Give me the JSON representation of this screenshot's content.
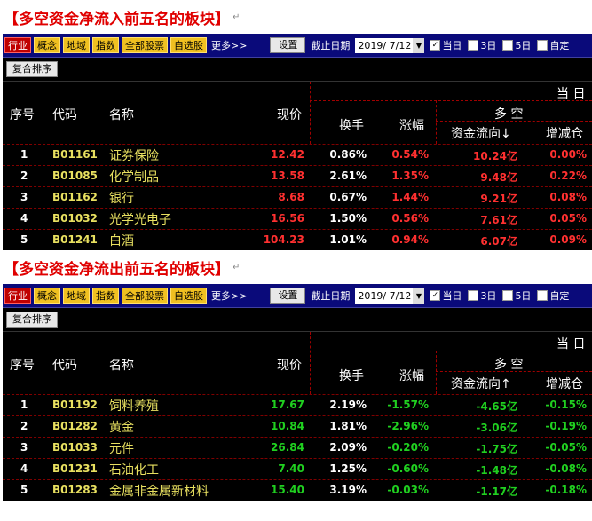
{
  "sections": [
    {
      "title": "【多空资金净流入前五名的板块】",
      "mark": "↵",
      "tabs": [
        "行业",
        "概念",
        "地域",
        "指数",
        "全部股票",
        "自选股"
      ],
      "active_tab": 0,
      "more": "更多>>",
      "set_button": "设置",
      "date_label": "截止日期",
      "date_value": "2019/ 7/12",
      "checks": [
        {
          "label": "当日",
          "checked": true
        },
        {
          "label": "3日",
          "checked": false
        },
        {
          "label": "5日",
          "checked": false
        },
        {
          "label": "自定",
          "checked": false
        }
      ],
      "sort_button": "复合排序",
      "headers": {
        "seq": "序号",
        "code": "代码",
        "name": "名称",
        "price": "现价",
        "group": "当 日",
        "sub": "多 空",
        "turnover": "换手",
        "change": "涨幅",
        "flow": "资金流向↓",
        "pos": "增减仓"
      },
      "color": "red",
      "rows": [
        {
          "seq": "1",
          "code": "B01161",
          "name": "证券保险",
          "price": "12.42",
          "turnover": "0.86%",
          "change": "0.54%",
          "flow": "10.24亿",
          "pos": "0.00%"
        },
        {
          "seq": "2",
          "code": "B01085",
          "name": "化学制品",
          "price": "13.58",
          "turnover": "2.61%",
          "change": "1.35%",
          "flow": "9.48亿",
          "pos": "0.22%"
        },
        {
          "seq": "3",
          "code": "B01162",
          "name": "银行",
          "price": "8.68",
          "turnover": "0.67%",
          "change": "1.44%",
          "flow": "9.21亿",
          "pos": "0.08%"
        },
        {
          "seq": "4",
          "code": "B01032",
          "name": "光学光电子",
          "price": "16.56",
          "turnover": "1.50%",
          "change": "0.56%",
          "flow": "7.61亿",
          "pos": "0.05%"
        },
        {
          "seq": "5",
          "code": "B01241",
          "name": "白酒",
          "price": "104.23",
          "turnover": "1.01%",
          "change": "0.94%",
          "flow": "6.07亿",
          "pos": "0.09%"
        }
      ]
    },
    {
      "title": "【多空资金净流出前五名的板块】",
      "mark": "↵",
      "tabs": [
        "行业",
        "概念",
        "地域",
        "指数",
        "全部股票",
        "自选股"
      ],
      "active_tab": 0,
      "more": "更多>>",
      "set_button": "设置",
      "date_label": "截止日期",
      "date_value": "2019/ 7/12",
      "checks": [
        {
          "label": "当日",
          "checked": true
        },
        {
          "label": "3日",
          "checked": false
        },
        {
          "label": "5日",
          "checked": false
        },
        {
          "label": "自定",
          "checked": false
        }
      ],
      "sort_button": "复合排序",
      "headers": {
        "seq": "序号",
        "code": "代码",
        "name": "名称",
        "price": "现价",
        "group": "当 日",
        "sub": "多 空",
        "turnover": "换手",
        "change": "涨幅",
        "flow": "资金流向↑",
        "pos": "增减仓"
      },
      "color": "green",
      "rows": [
        {
          "seq": "1",
          "code": "B01192",
          "name": "饲料养殖",
          "price": "17.67",
          "turnover": "2.19%",
          "change": "-1.57%",
          "flow": "-4.65亿",
          "pos": "-0.15%"
        },
        {
          "seq": "2",
          "code": "B01282",
          "name": "黄金",
          "price": "10.84",
          "turnover": "1.81%",
          "change": "-2.96%",
          "flow": "-3.06亿",
          "pos": "-0.19%"
        },
        {
          "seq": "3",
          "code": "B01033",
          "name": "元件",
          "price": "26.84",
          "turnover": "2.09%",
          "change": "-0.20%",
          "flow": "-1.75亿",
          "pos": "-0.05%"
        },
        {
          "seq": "4",
          "code": "B01231",
          "name": "石油化工",
          "price": "7.40",
          "turnover": "1.25%",
          "change": "-0.60%",
          "flow": "-1.48亿",
          "pos": "-0.08%"
        },
        {
          "seq": "5",
          "code": "B01283",
          "name": "金属非金属新材料",
          "price": "15.40",
          "turnover": "3.19%",
          "change": "-0.03%",
          "flow": "-1.17亿",
          "pos": "-0.18%"
        }
      ]
    }
  ]
}
